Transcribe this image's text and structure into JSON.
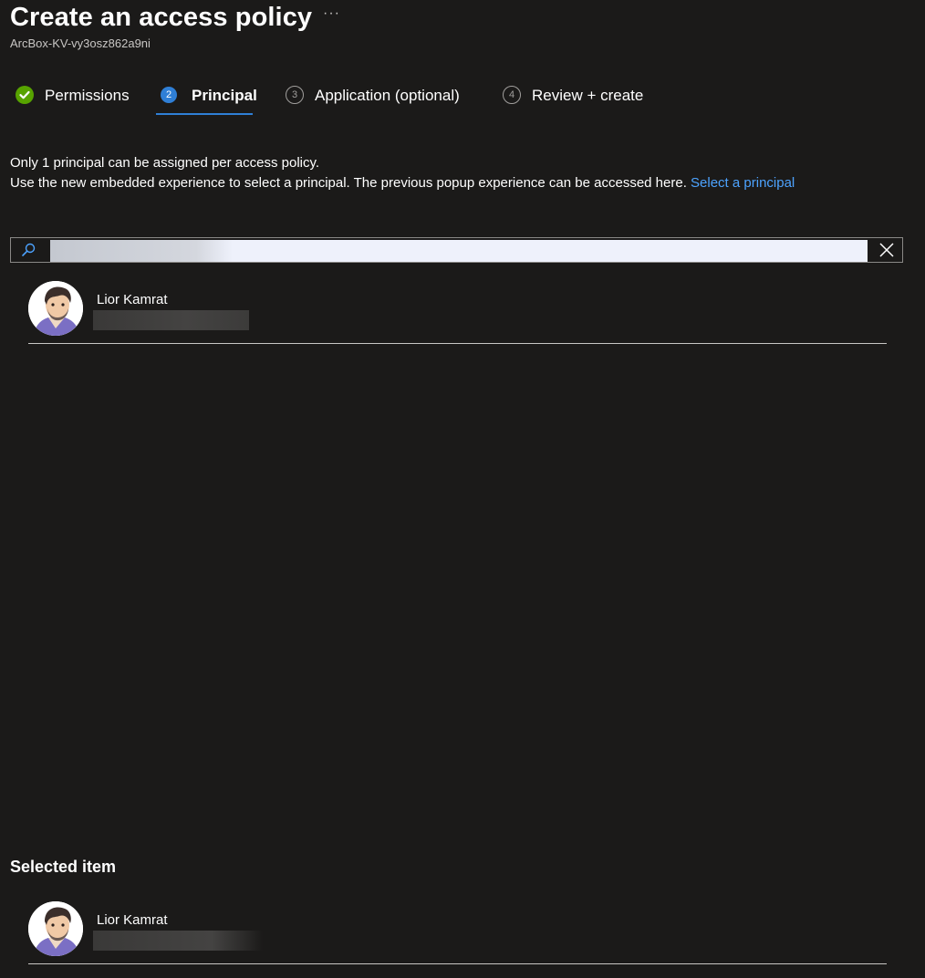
{
  "header": {
    "title": "Create an access policy",
    "more_label": "···",
    "subtitle": "ArcBox-KV-vy3osz862a9ni"
  },
  "tabs": [
    {
      "label": "Permissions",
      "state": "done",
      "step": ""
    },
    {
      "label": "Principal",
      "state": "active",
      "step": "2"
    },
    {
      "label": "Application (optional)",
      "state": "pending",
      "step": "3"
    },
    {
      "label": "Review + create",
      "state": "pending",
      "step": "4"
    }
  ],
  "info": {
    "line1": "Only 1 principal can be assigned per access policy.",
    "line2": "Use the new embedded experience to select a principal. The previous popup experience can be accessed here.",
    "link": "Select a principal"
  },
  "search": {
    "value": ""
  },
  "results": [
    {
      "name": "Lior Kamrat"
    }
  ],
  "selected": {
    "title": "Selected item",
    "items": [
      {
        "name": "Lior Kamrat"
      }
    ]
  },
  "colors": {
    "background": "#1b1a19",
    "accent": "#2f7fd6",
    "success": "#57a300",
    "link": "#4da3ff"
  },
  "icons": {
    "search": "search-icon",
    "clear": "close-icon",
    "done": "checkmark-icon"
  }
}
